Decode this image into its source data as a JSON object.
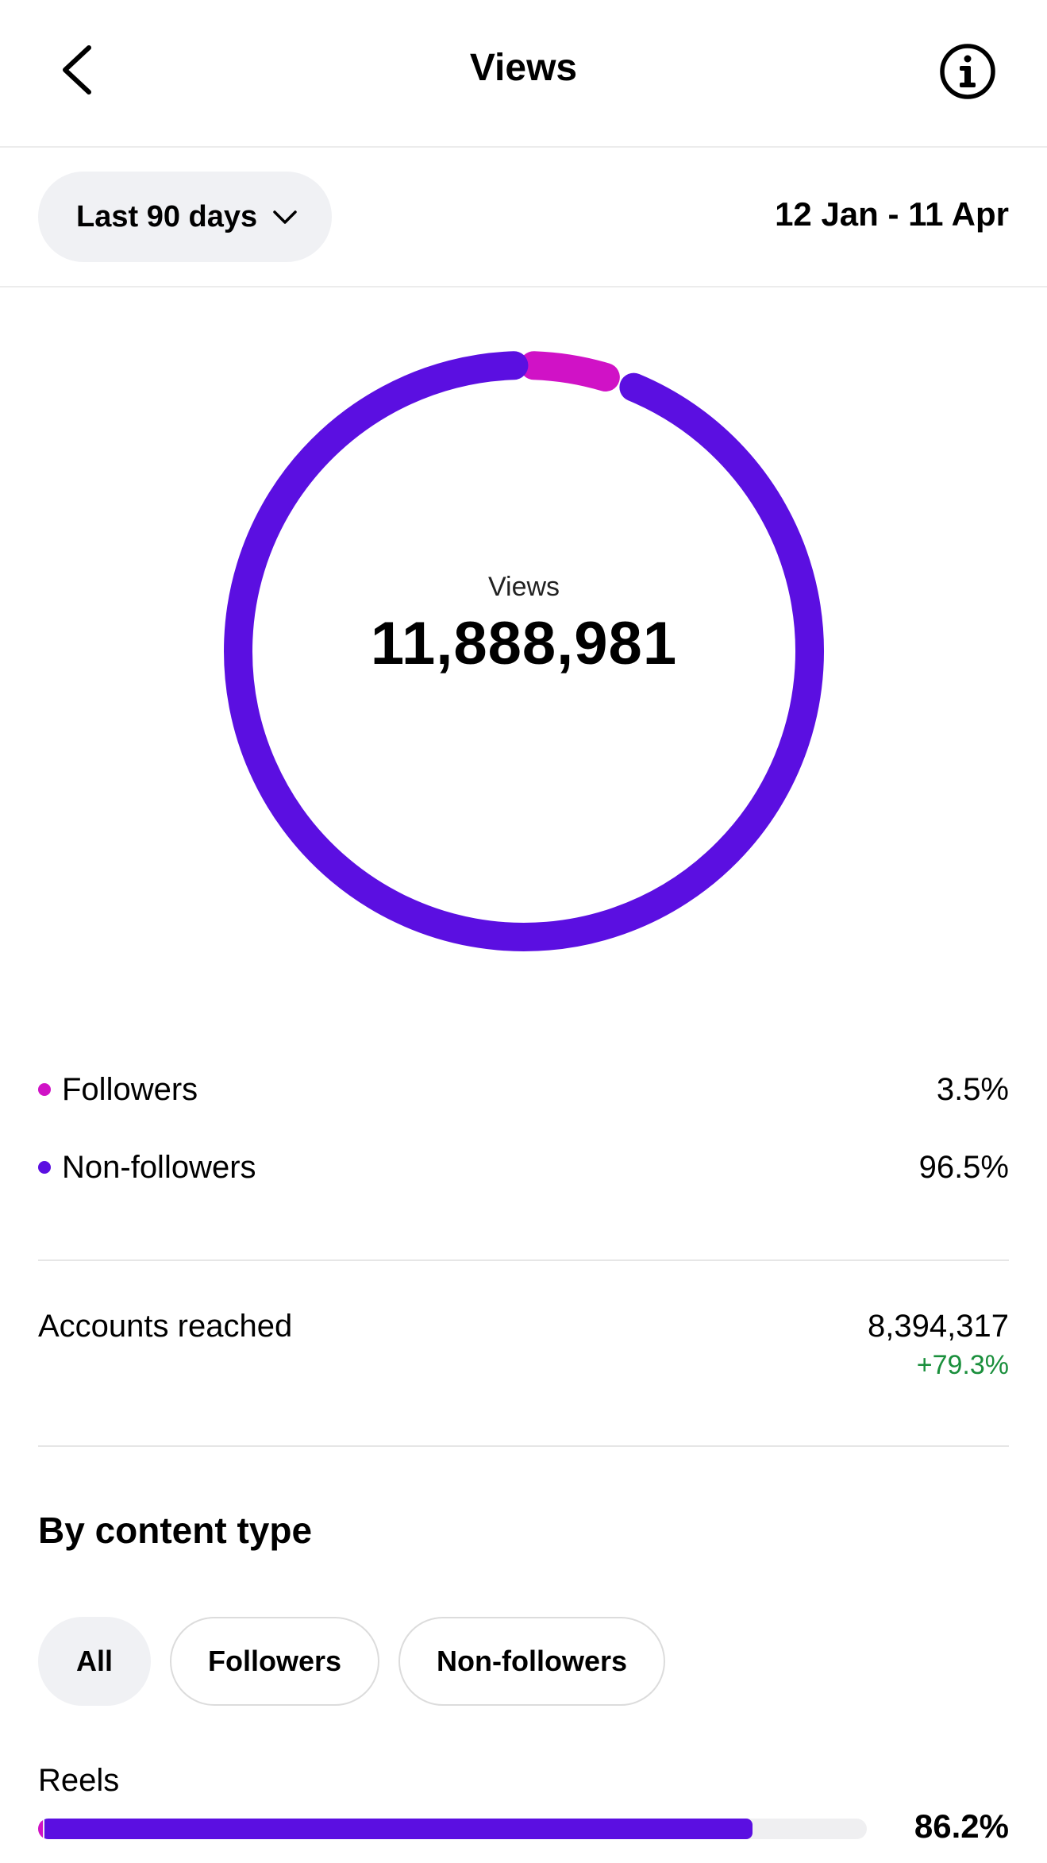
{
  "header": {
    "title": "Views"
  },
  "filter": {
    "range_label": "Last 90 days",
    "date_range": "12 Jan - 11 Apr"
  },
  "donut": {
    "label": "Views",
    "value": "11,888,981"
  },
  "breakdown": [
    {
      "label": "Followers",
      "value": "3.5%",
      "fraction": 0.035,
      "color": "#d012c6"
    },
    {
      "label": "Non-followers",
      "value": "96.5%",
      "fraction": 0.965,
      "color": "#5b0fe1"
    }
  ],
  "reach": {
    "label": "Accounts reached",
    "value": "8,394,317",
    "change": "+79.3%"
  },
  "content_type": {
    "title": "By content type",
    "chips": [
      "All",
      "Followers",
      "Non-followers"
    ],
    "active_chip": "All",
    "rows": [
      {
        "label": "Reels",
        "value": "86.2%",
        "fraction": 0.862,
        "followers_fraction": 0.005
      }
    ]
  },
  "colors": {
    "followers": "#d012c6",
    "non_followers": "#5b0fe1",
    "positive": "#1a8f3c"
  }
}
